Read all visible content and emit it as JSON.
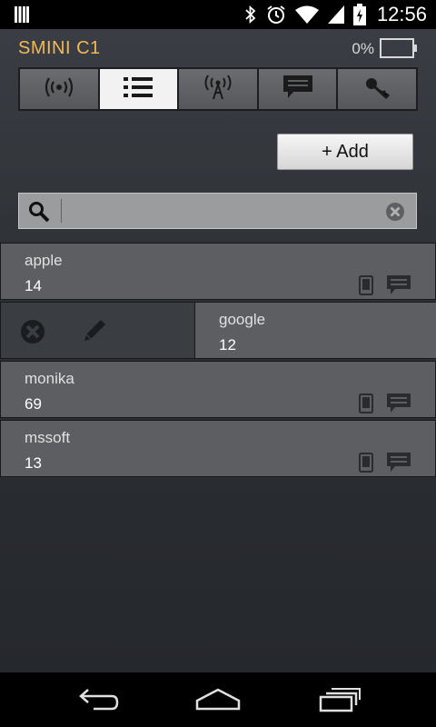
{
  "status_bar": {
    "time": "12:56",
    "icons": [
      "sim-card-icon",
      "bluetooth-icon",
      "alarm-icon",
      "wifi-icon",
      "signal-icon",
      "battery-charging-icon"
    ]
  },
  "header": {
    "title": "SMINI C1",
    "battery_percent": "0%"
  },
  "tabs": [
    {
      "icon": "broadcast-icon",
      "active": false
    },
    {
      "icon": "list-icon",
      "active": true
    },
    {
      "icon": "antenna-icon",
      "active": false
    },
    {
      "icon": "message-icon",
      "active": false
    },
    {
      "icon": "key-icon",
      "active": false
    }
  ],
  "toolbar": {
    "add_label": "+ Add"
  },
  "search": {
    "value": "",
    "placeholder": ""
  },
  "contacts": [
    {
      "name": "apple",
      "count": "14"
    },
    {
      "name": "google",
      "count": "12",
      "swiped": true
    },
    {
      "name": "monika",
      "count": "69"
    },
    {
      "name": "mssoft",
      "count": "13"
    }
  ],
  "colors": {
    "accent": "#f0b959",
    "row_bg": "#5c5e62",
    "active_tab": "#f2f2f2"
  },
  "nav": {
    "icons": [
      "back-icon",
      "home-icon",
      "recent-apps-icon"
    ]
  }
}
